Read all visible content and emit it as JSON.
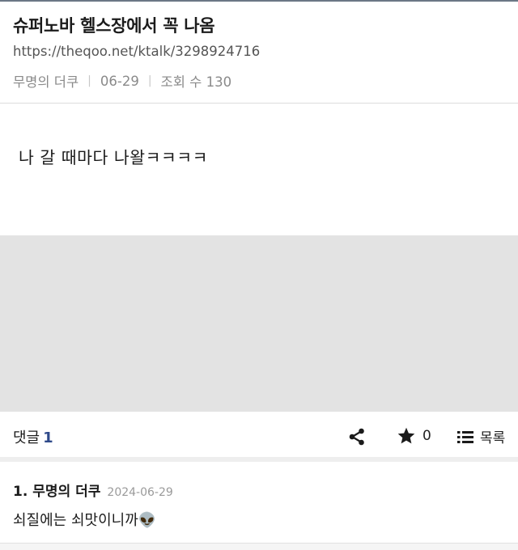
{
  "post": {
    "title": "슈퍼노바 헬스장에서 꼭 나옴",
    "url": "https://theqoo.net/ktalk/3298924716",
    "author": "무명의 더쿠",
    "date": "06-29",
    "views_label": "조회 수 130",
    "content": "나 갈 때마다 나왈ㅋㅋㅋㅋ"
  },
  "actions": {
    "comment_label": "댓글",
    "comment_count": "1",
    "favorite_count": "0",
    "list_label": "목록"
  },
  "comments": [
    {
      "number": "1.",
      "author": "무명의 더쿠",
      "date": "2024-06-29",
      "body": "쇠질에는 쇠맛이니까👽"
    }
  ],
  "colors": {
    "accent": "#2f4a8a",
    "placeholder": "#e3e3e3",
    "top_border": "#6b7785"
  },
  "icons": [
    "share-icon",
    "star-icon",
    "list-icon"
  ]
}
